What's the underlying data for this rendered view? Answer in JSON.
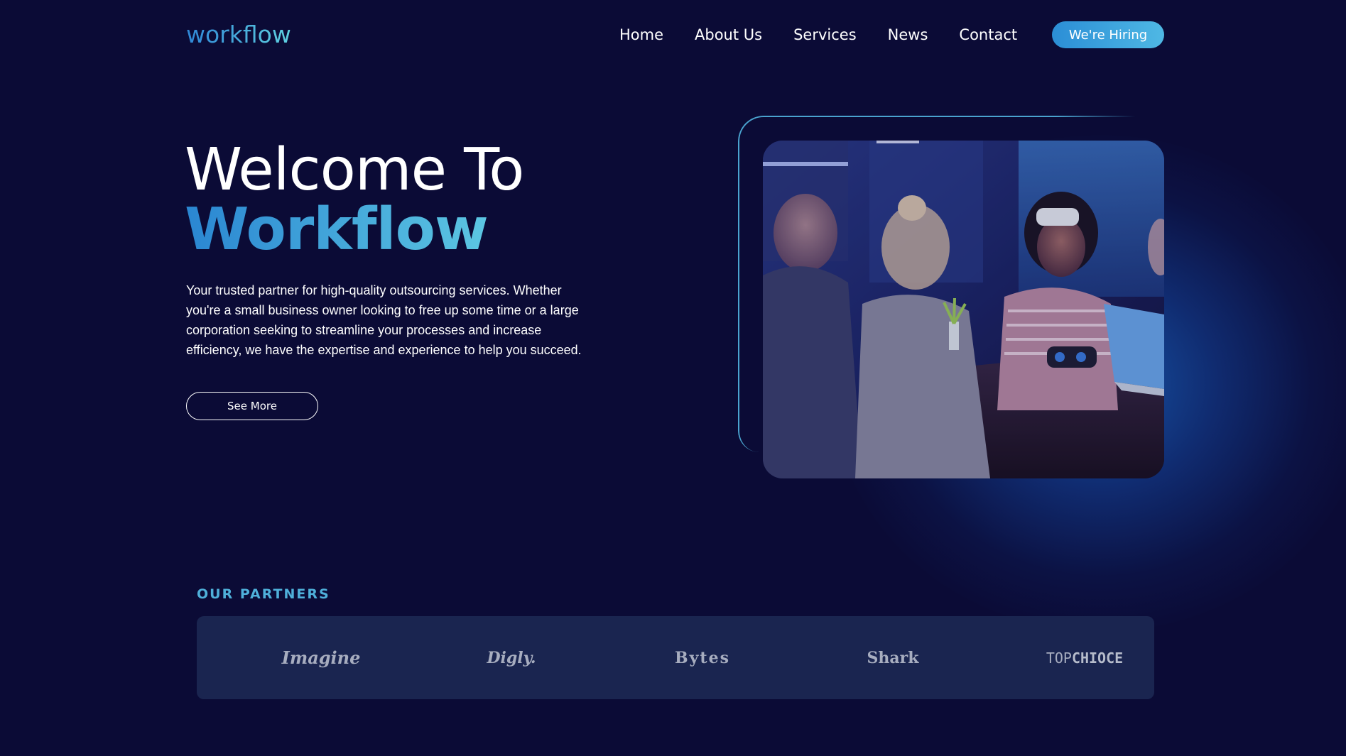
{
  "brand": {
    "logo_text": "workflow"
  },
  "nav": {
    "items": [
      {
        "label": "Home"
      },
      {
        "label": "About Us"
      },
      {
        "label": "Services"
      },
      {
        "label": "News"
      },
      {
        "label": "Contact"
      }
    ],
    "cta_label": "We're Hiring"
  },
  "hero": {
    "title_line1": "Welcome To",
    "title_line2": "Workflow",
    "description": "Your trusted partner for high-quality outsourcing services. Whether you're a small business owner looking to free up some time or a large corporation seeking to streamline your processes and increase efficiency, we have the expertise and experience to help you succeed.",
    "button_label": "See More"
  },
  "partners": {
    "heading": "OUR PARTNERS",
    "logos": [
      {
        "name": "Imagine"
      },
      {
        "name": "Digly."
      },
      {
        "name": "Bytes"
      },
      {
        "name": "Shark"
      },
      {
        "name_part1": "TOP",
        "name_part2": "CHIOCE"
      }
    ]
  },
  "colors": {
    "background": "#0b0b36",
    "accent": "#3aa6d9",
    "partners_panel": "#1a2550",
    "partner_logo": "#a7adbf"
  }
}
